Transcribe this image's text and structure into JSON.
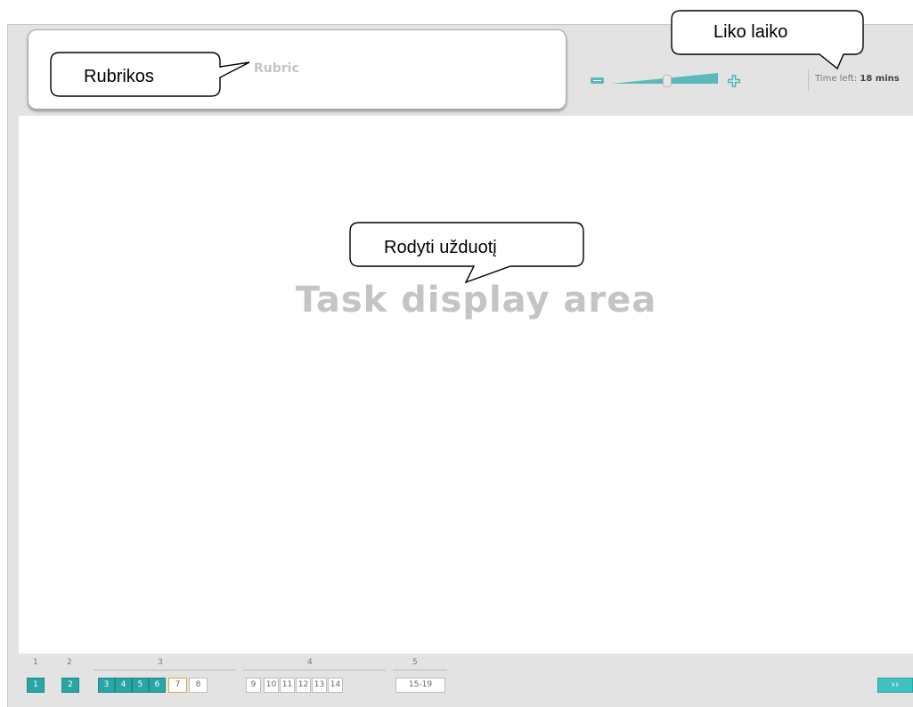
{
  "rubric": {
    "label": "Rubric"
  },
  "task": {
    "label": "Task display area"
  },
  "timer": {
    "prefix": "Time left:",
    "value": "18 mins"
  },
  "callouts": {
    "rubric": "Rubrikos",
    "timer": "Liko laiko",
    "task": "Rodyti užduotį"
  },
  "zoom": {
    "minus_icon": "minus-icon",
    "plus_icon": "plus-icon",
    "level": 0.5
  },
  "navigation": {
    "groups": [
      {
        "number": "1",
        "items": [
          {
            "label": "1",
            "state": "done"
          }
        ]
      },
      {
        "number": "2",
        "items": [
          {
            "label": "2",
            "state": "done"
          }
        ]
      },
      {
        "number": "3",
        "items": [
          {
            "label": "3",
            "state": "done"
          },
          {
            "label": "4",
            "state": "done"
          },
          {
            "label": "5",
            "state": "done"
          },
          {
            "label": "6",
            "state": "done"
          },
          {
            "label": "7",
            "state": "current"
          },
          {
            "label": "8",
            "state": "todo"
          }
        ]
      },
      {
        "number": "4",
        "items": [
          {
            "label": "9",
            "state": "todo"
          },
          {
            "label": "10",
            "state": "todo"
          },
          {
            "label": "11",
            "state": "todo"
          },
          {
            "label": "12",
            "state": "todo"
          },
          {
            "label": "13",
            "state": "todo"
          },
          {
            "label": "14",
            "state": "todo"
          }
        ]
      },
      {
        "number": "5",
        "items": [
          {
            "label": "15-19",
            "state": "todo"
          }
        ]
      }
    ],
    "next_label": "››"
  },
  "colors": {
    "accent": "#2aa5a5",
    "current_border": "#e6a23c",
    "background": "#e3e3e3"
  }
}
